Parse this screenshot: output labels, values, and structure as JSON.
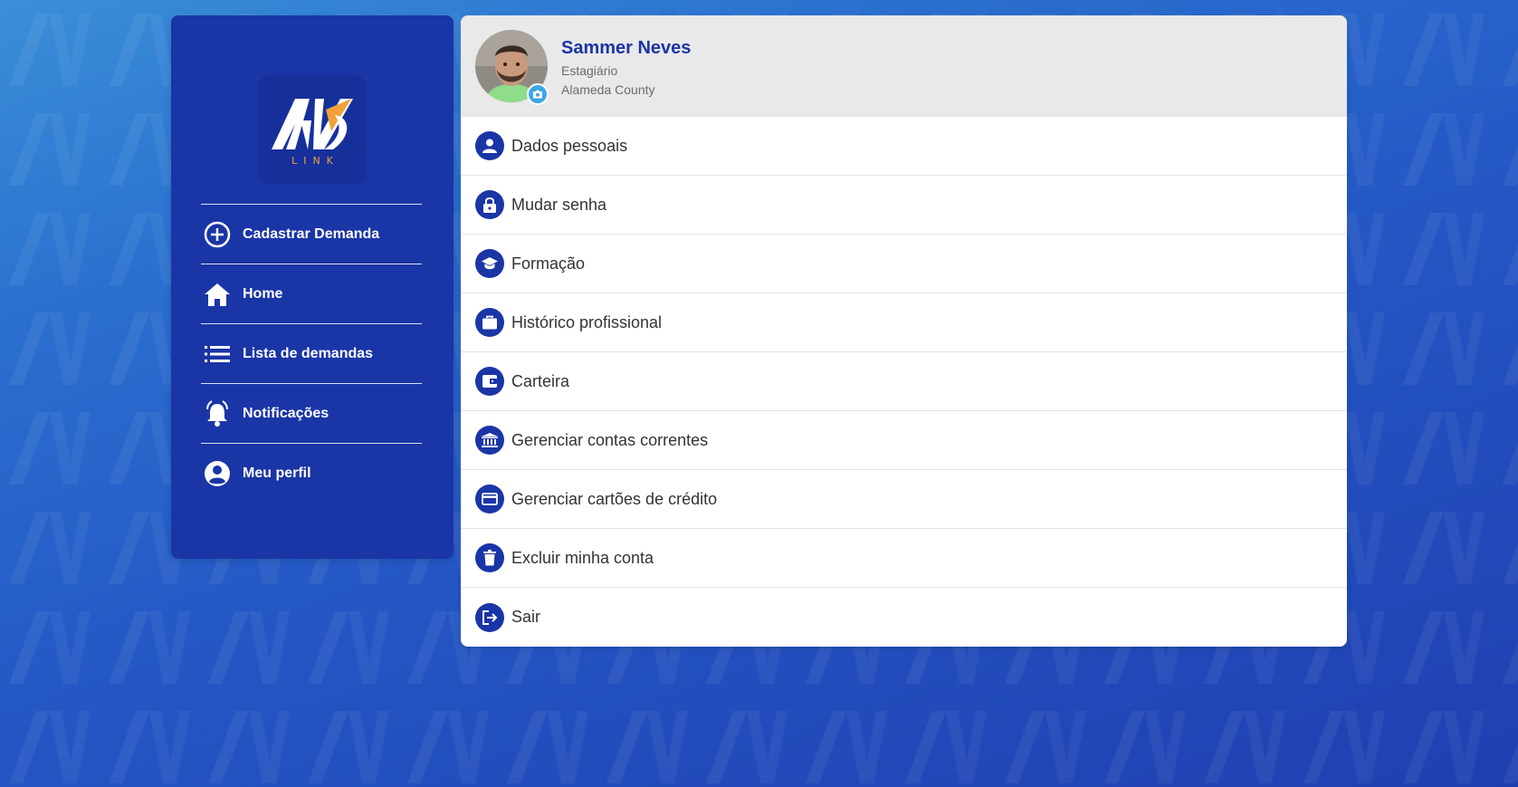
{
  "brand": {
    "logo_mark": "AV",
    "logo_sub": "LINK",
    "accent": "#f2a03a",
    "primary": "#1a35a6"
  },
  "sidebar": {
    "items": [
      {
        "label": "Cadastrar Demanda",
        "icon": "plus-circle-icon"
      },
      {
        "label": "Home",
        "icon": "home-icon"
      },
      {
        "label": "Lista de demandas",
        "icon": "list-icon"
      },
      {
        "label": "Notificações",
        "icon": "bell-icon"
      },
      {
        "label": "Meu perfil",
        "icon": "user-circle-icon"
      }
    ]
  },
  "profile": {
    "name": "Sammer Neves",
    "role": "Estagiário",
    "location": "Alameda County"
  },
  "menu": {
    "items": [
      {
        "label": "Dados pessoais",
        "icon": "person-icon"
      },
      {
        "label": "Mudar senha",
        "icon": "lock-icon"
      },
      {
        "label": "Formação",
        "icon": "graduation-cap-icon"
      },
      {
        "label": "Histórico profissional",
        "icon": "briefcase-icon"
      },
      {
        "label": "Carteira",
        "icon": "wallet-icon"
      },
      {
        "label": "Gerenciar contas correntes",
        "icon": "bank-icon"
      },
      {
        "label": "Gerenciar cartões de crédito",
        "icon": "credit-card-icon"
      },
      {
        "label": "Excluir minha conta",
        "icon": "trash-icon"
      },
      {
        "label": "Sair",
        "icon": "logout-icon"
      }
    ]
  }
}
